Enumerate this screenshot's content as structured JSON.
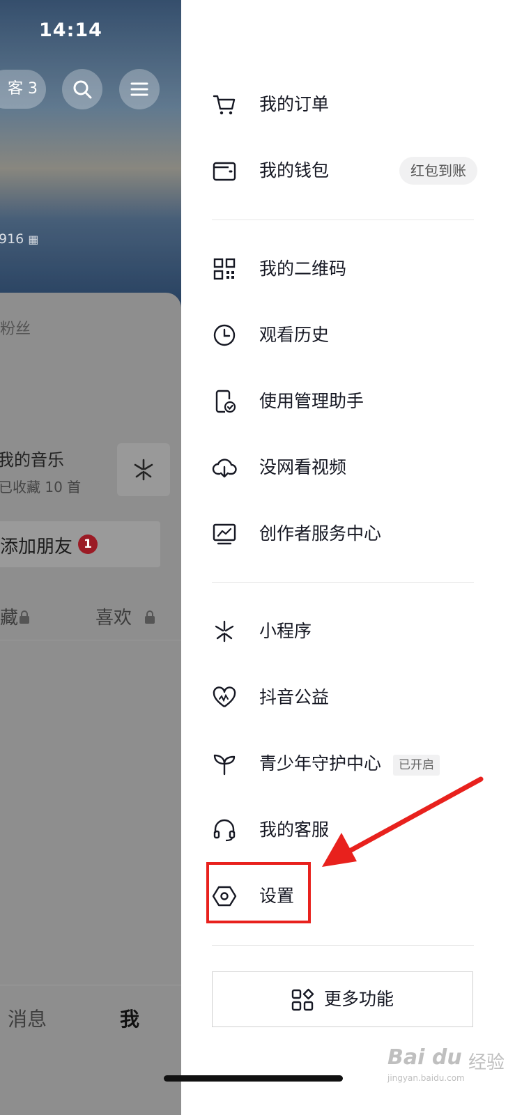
{
  "status_bar": {
    "time": "14:14"
  },
  "background": {
    "visitor_label": "客 3",
    "id_text": "916 ",
    "fans_label": "粉丝",
    "music_title": "我的音乐",
    "music_sub": "已收藏 10 首",
    "add_friend": "添加朋友",
    "add_friend_badge": "1",
    "tab_collect": "藏",
    "tab_like": "喜欢",
    "nav_message": "消息",
    "nav_me": "我"
  },
  "menu": {
    "items": [
      {
        "label": "我的订单",
        "icon": "cart-icon"
      },
      {
        "label": "我的钱包",
        "icon": "wallet-icon",
        "pill": "红包到账"
      },
      {
        "label": "我的二维码",
        "icon": "qrcode-icon"
      },
      {
        "label": "观看历史",
        "icon": "clock-icon"
      },
      {
        "label": "使用管理助手",
        "icon": "phone-check-icon"
      },
      {
        "label": "没网看视频",
        "icon": "cloud-download-icon"
      },
      {
        "label": "创作者服务中心",
        "icon": "monitor-chart-icon"
      },
      {
        "label": "小程序",
        "icon": "miniprogram-icon"
      },
      {
        "label": "抖音公益",
        "icon": "heart-icon"
      },
      {
        "label": "青少年守护中心",
        "icon": "sprout-icon",
        "tag": "已开启"
      },
      {
        "label": "我的客服",
        "icon": "headset-icon"
      },
      {
        "label": "设置",
        "icon": "settings-hexagon-icon"
      }
    ],
    "more_button": "更多功能"
  },
  "watermark": {
    "logo": "Bai du",
    "sub": "经验",
    "url": "jingyan.baidu.com"
  },
  "colors": {
    "highlight": "#e8211d",
    "badge": "#9b1b25",
    "overlay": "#8e8e8e"
  }
}
